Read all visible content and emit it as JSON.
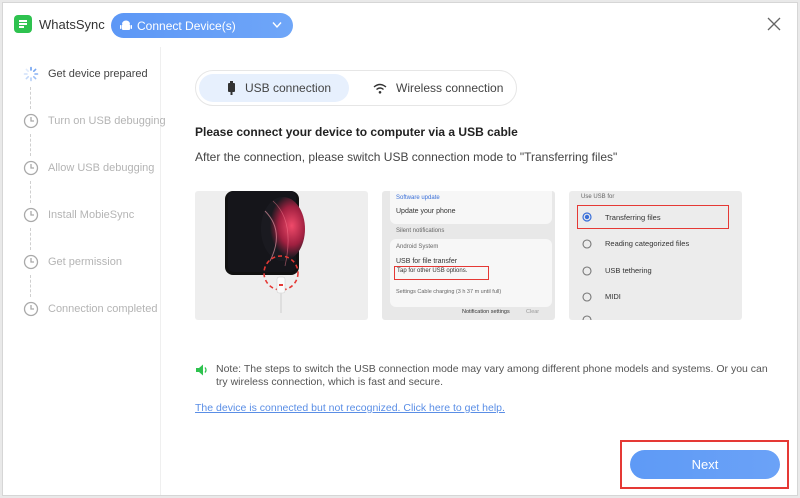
{
  "app": {
    "name": "WhatsSync"
  },
  "header": {
    "device_button": "Connect Device(s)"
  },
  "steps": [
    {
      "label": "Get device prepared",
      "status": "active"
    },
    {
      "label": "Turn on USB debugging",
      "status": "pending"
    },
    {
      "label": "Allow USB debugging",
      "status": "pending"
    },
    {
      "label": "Install MobieSync",
      "status": "pending"
    },
    {
      "label": "Get permission",
      "status": "pending"
    },
    {
      "label": "Connection completed",
      "status": "pending"
    }
  ],
  "tabs": [
    {
      "label": "USB connection",
      "selected": true
    },
    {
      "label": "Wireless connection",
      "selected": false
    }
  ],
  "main": {
    "heading": "Please connect your device to computer via a USB cable",
    "subtext": "After the connection, please switch USB connection mode to \"Transferring files\""
  },
  "screenshot2": {
    "software_update": "Software update",
    "update_phone": "Update your phone",
    "silent_notifications": "Silent notifications",
    "android_system": "Android System",
    "usb_file_transfer": "USB for file transfer",
    "tap_options": "Tap for other USB options.",
    "settings_line": "Settings  Cable charging (3 h 37 m until full)",
    "notif_settings": "Notification settings",
    "clear": "Clear"
  },
  "screenshot3": {
    "header": "Use USB for",
    "options": [
      "Transferring files",
      "Reading categorized files",
      "USB tethering",
      "MIDI"
    ],
    "selected": "Transferring files"
  },
  "note": "Note: The steps to switch the USB connection mode may vary among different phone models and systems. Or you can try wireless connection, which is fast and secure.",
  "help_link": "The device is connected but not recognized. Click here to get help.",
  "buttons": {
    "next": "Next"
  },
  "colors": {
    "accent": "#5e9af6",
    "logo": "#2ec24f",
    "highlight": "#e53935",
    "speaker": "#2ec24f"
  }
}
